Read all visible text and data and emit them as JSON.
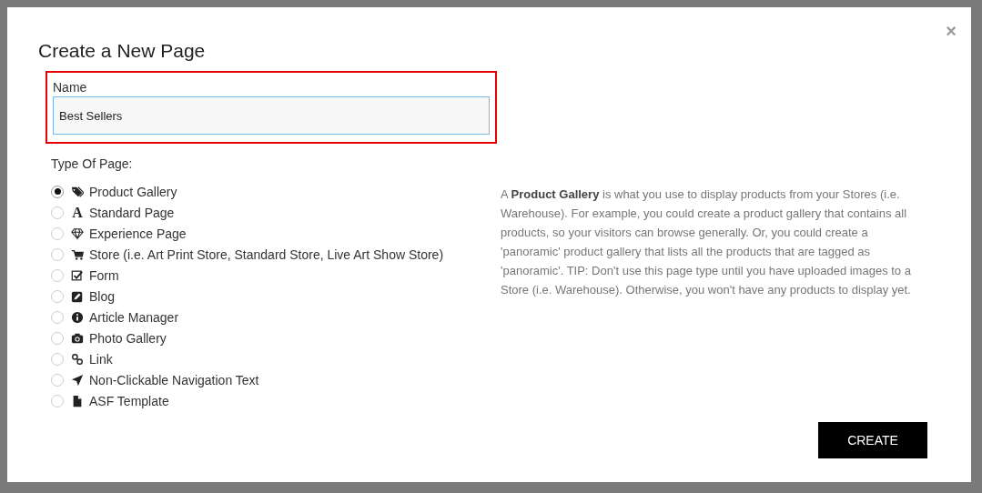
{
  "dialog": {
    "title": "Create a New Page",
    "close": "×"
  },
  "name_field": {
    "label": "Name",
    "value": "Best Sellers",
    "highlighted": true
  },
  "page_type": {
    "label": "Type Of Page:",
    "options": [
      {
        "label": "Product Gallery",
        "kind": "tags",
        "selected": true
      },
      {
        "label": "Standard Page",
        "kind": "glyph",
        "glyph": "A",
        "selected": false
      },
      {
        "label": "Experience Page",
        "kind": "diamond",
        "selected": false
      },
      {
        "label": "Store (i.e. Art Print Store, Standard Store, Live Art Show Store)",
        "kind": "cart",
        "selected": false
      },
      {
        "label": "Form",
        "kind": "check",
        "selected": false
      },
      {
        "label": "Blog",
        "kind": "edit",
        "selected": false
      },
      {
        "label": "Article Manager",
        "kind": "info",
        "selected": false
      },
      {
        "label": "Photo Gallery",
        "kind": "camera",
        "selected": false
      },
      {
        "label": "Link",
        "kind": "link",
        "selected": false
      },
      {
        "label": "Non-Clickable Navigation Text",
        "kind": "arrow",
        "selected": false
      },
      {
        "label": "ASF Template",
        "kind": "file",
        "selected": false
      }
    ]
  },
  "description": "A **Product Gallery** is what you use to display products from your Stores (i.e. Warehouse). For example, you could create a product gallery that contains all products, so your visitors can browse generally. Or, you could create a 'panoramic' product gallery that lists all the products that are tagged as 'panoramic'. TIP: Don't use this page type until you have uploaded images to a Store (i.e. Warehouse). Otherwise, you won't have any products to display yet.",
  "buttons": [
    "CREATE"
  ]
}
